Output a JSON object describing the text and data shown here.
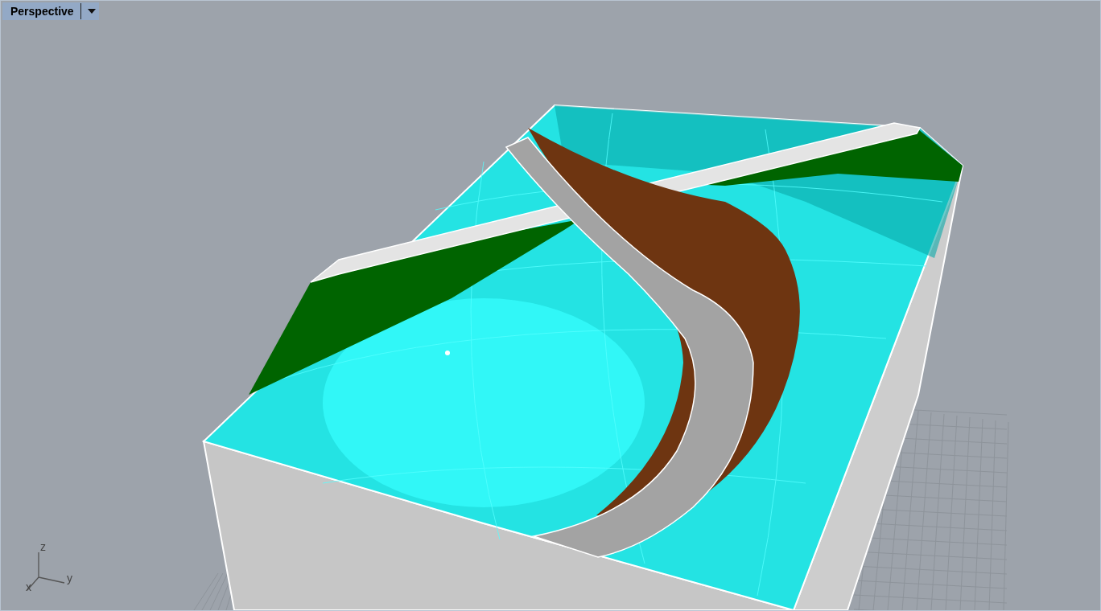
{
  "viewport": {
    "title": "Perspective",
    "axes": [
      {
        "label": "z"
      },
      {
        "label": "y"
      },
      {
        "label": "x"
      }
    ]
  }
}
